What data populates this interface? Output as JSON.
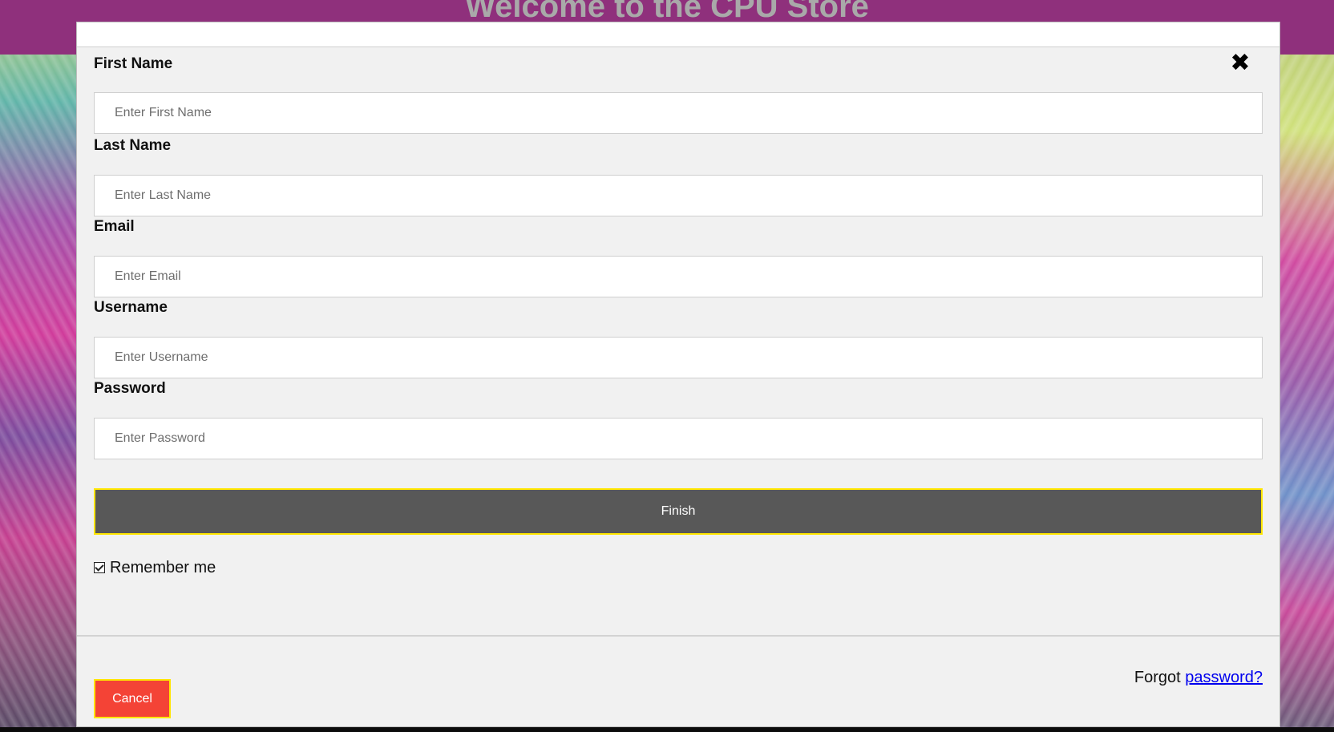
{
  "site": {
    "title": "Welcome to the CPU Store"
  },
  "modal": {
    "close_symbol": "✖",
    "fields": [
      {
        "label": "First Name",
        "placeholder": "Enter First Name",
        "value": ""
      },
      {
        "label": "Last Name",
        "placeholder": "Enter Last Name",
        "value": ""
      },
      {
        "label": "Email",
        "placeholder": "Enter Email",
        "value": ""
      },
      {
        "label": "Username",
        "placeholder": "Enter Username",
        "value": ""
      },
      {
        "label": "Password",
        "placeholder": "Enter Password",
        "value": ""
      }
    ],
    "finish_label": "Finish",
    "remember": {
      "label": "Remember me",
      "checked": true
    },
    "cancel_label": "Cancel",
    "forgot": {
      "prefix": "Forgot",
      "link": "password?"
    }
  },
  "colors": {
    "header": "#8f307c",
    "finish_button": "#585858",
    "cancel_button": "#f44336",
    "button_border": "#ffe600",
    "link": "#0000ee"
  },
  "icons": {
    "close": "close-icon",
    "checkbox": "checkbox-checked-icon"
  }
}
